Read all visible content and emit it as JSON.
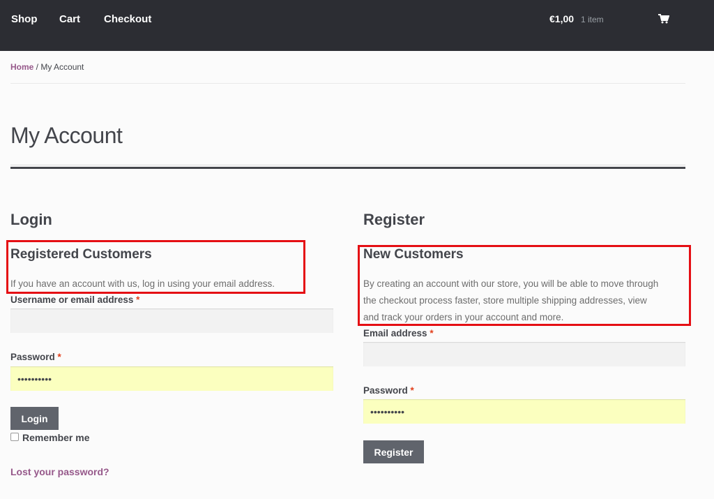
{
  "nav": {
    "items": [
      {
        "label": "Shop"
      },
      {
        "label": "Cart"
      },
      {
        "label": "Checkout"
      }
    ],
    "cart_total": "€1,00",
    "cart_count": "1 item",
    "cart_icon": "shopping-cart-icon"
  },
  "breadcrumb": {
    "home": "Home",
    "separator": " / ",
    "current": "My Account"
  },
  "page": {
    "title": "My Account"
  },
  "login": {
    "heading": "Login",
    "sub_heading": "Registered Customers",
    "intro": "If you have an account with us, log in using your email address.",
    "username_label": "Username or email address",
    "username_value": "",
    "password_label": "Password",
    "password_value": "••••••••••",
    "button": "Login",
    "remember": "Remember me",
    "lost_password": "Lost your password?"
  },
  "register": {
    "heading": "Register",
    "sub_heading": "New Customers",
    "intro_lines": [
      "By creating an account with our store, you will be able to move through",
      "the checkout process faster, store multiple shipping addresses, view",
      "and track your orders in your account and more."
    ],
    "email_label": "Email address",
    "email_value": "",
    "password_label": "Password",
    "password_value": "••••••••••",
    "button": "Register"
  },
  "required_marker": "*",
  "colors": {
    "topbar": "#2c2d33",
    "link": "#96588a",
    "highlight": "#e50f14",
    "button": "#60646c",
    "autofill": "#fbffbf"
  }
}
